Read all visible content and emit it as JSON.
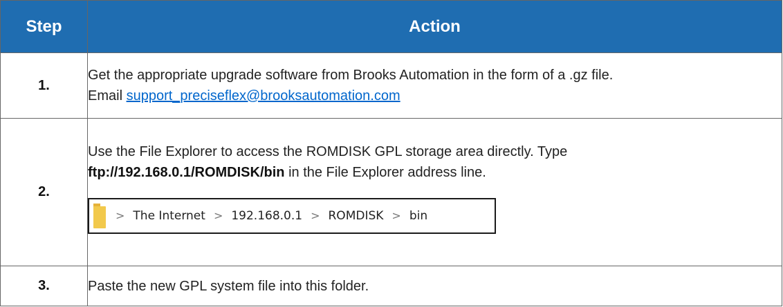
{
  "table": {
    "headers": {
      "step": "Step",
      "action": "Action"
    },
    "rows": [
      {
        "step": "1.",
        "line1": "Get the appropriate upgrade software from Brooks Automation in the form of a .gz file.",
        "email_prefix": "Email ",
        "email_link": "support_preciseflex@brooksautomation.com"
      },
      {
        "step": "2.",
        "line1": "Use the File Explorer to access the ROMDISK GPL storage area directly. Type",
        "command": "ftp://192.168.0.1/ROMDISK/bin",
        "line2_suffix": " in the File Explorer address line.",
        "address_bar": {
          "separator": ">",
          "crumbs": [
            "The Internet",
            "192.168.0.1",
            "ROMDISK",
            "bin"
          ]
        }
      },
      {
        "step": "3.",
        "text": "Paste the new GPL system file into this folder."
      }
    ]
  },
  "colors": {
    "header_bg": "#1f6db1",
    "header_text": "#ffffff",
    "link": "#0066cc",
    "folder": "#f2c94c"
  }
}
